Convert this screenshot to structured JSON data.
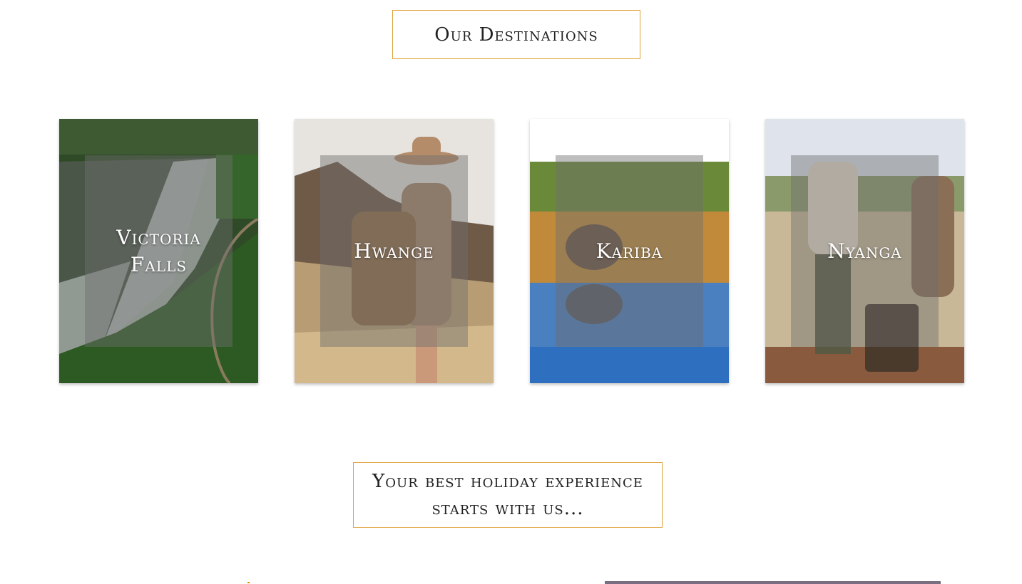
{
  "header": {
    "title": "Our Destinations"
  },
  "destinations": [
    {
      "name": "Victoria Falls"
    },
    {
      "name": "Hwange"
    },
    {
      "name": "Kariba"
    },
    {
      "name": "Nyanga"
    }
  ],
  "tagline": {
    "text": "Your best holiday experience starts with us..."
  },
  "colors": {
    "accent": "#e0a23c",
    "text": "#222222"
  }
}
